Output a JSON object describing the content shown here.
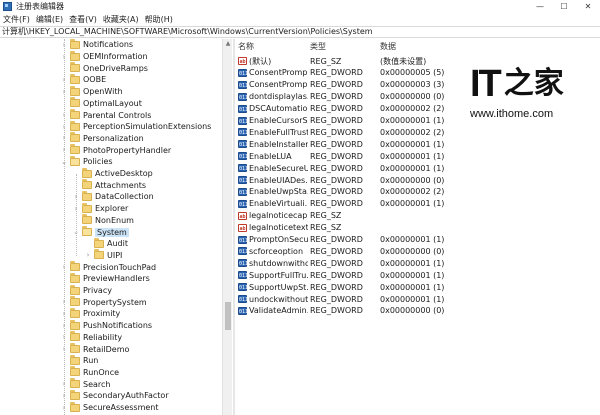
{
  "window": {
    "title": "注册表编辑器",
    "controls": {
      "minimize": "—",
      "maximize": "☐",
      "close": "✕"
    }
  },
  "menu": [
    "文件(F)",
    "编辑(E)",
    "查看(V)",
    "收藏夹(A)",
    "帮助(H)"
  ],
  "address": "计算机\\HKEY_LOCAL_MACHINE\\SOFTWARE\\Microsoft\\Windows\\CurrentVersion\\Policies\\System",
  "tree": [
    {
      "label": "Notifications",
      "depth": 0,
      "expander": "collapsed",
      "selected": false
    },
    {
      "label": "OEMInformation",
      "depth": 0,
      "expander": "collapsed",
      "selected": false
    },
    {
      "label": "OneDriveRamps",
      "depth": 0,
      "expander": "none",
      "selected": false
    },
    {
      "label": "OOBE",
      "depth": 0,
      "expander": "collapsed",
      "selected": false
    },
    {
      "label": "OpenWith",
      "depth": 0,
      "expander": "collapsed",
      "selected": false
    },
    {
      "label": "OptimalLayout",
      "depth": 0,
      "expander": "none",
      "selected": false
    },
    {
      "label": "Parental Controls",
      "depth": 0,
      "expander": "collapsed",
      "selected": false
    },
    {
      "label": "PerceptionSimulationExtensions",
      "depth": 0,
      "expander": "collapsed",
      "selected": false
    },
    {
      "label": "Personalization",
      "depth": 0,
      "expander": "collapsed",
      "selected": false
    },
    {
      "label": "PhotoPropertyHandler",
      "depth": 0,
      "expander": "collapsed",
      "selected": false
    },
    {
      "label": "Policies",
      "depth": 0,
      "expander": "expanded",
      "selected": false
    },
    {
      "label": "ActiveDesktop",
      "depth": 1,
      "expander": "none",
      "selected": false
    },
    {
      "label": "Attachments",
      "depth": 1,
      "expander": "none",
      "selected": false
    },
    {
      "label": "DataCollection",
      "depth": 1,
      "expander": "collapsed",
      "selected": false
    },
    {
      "label": "Explorer",
      "depth": 1,
      "expander": "collapsed",
      "selected": false
    },
    {
      "label": "NonEnum",
      "depth": 1,
      "expander": "none",
      "selected": false
    },
    {
      "label": "System",
      "depth": 1,
      "expander": "expanded",
      "selected": true
    },
    {
      "label": "Audit",
      "depth": 2,
      "expander": "none",
      "selected": false
    },
    {
      "label": "UIPI",
      "depth": 2,
      "expander": "collapsed",
      "selected": false
    },
    {
      "label": "PrecisionTouchPad",
      "depth": 0,
      "expander": "collapsed",
      "selected": false
    },
    {
      "label": "PreviewHandlers",
      "depth": 0,
      "expander": "none",
      "selected": false
    },
    {
      "label": "Privacy",
      "depth": 0,
      "expander": "none",
      "selected": false
    },
    {
      "label": "PropertySystem",
      "depth": 0,
      "expander": "collapsed",
      "selected": false
    },
    {
      "label": "Proximity",
      "depth": 0,
      "expander": "collapsed",
      "selected": false
    },
    {
      "label": "PushNotifications",
      "depth": 0,
      "expander": "collapsed",
      "selected": false
    },
    {
      "label": "Reliability",
      "depth": 0,
      "expander": "collapsed",
      "selected": false
    },
    {
      "label": "RetailDemo",
      "depth": 0,
      "expander": "collapsed",
      "selected": false
    },
    {
      "label": "Run",
      "depth": 0,
      "expander": "none",
      "selected": false
    },
    {
      "label": "RunOnce",
      "depth": 0,
      "expander": "none",
      "selected": false
    },
    {
      "label": "Search",
      "depth": 0,
      "expander": "collapsed",
      "selected": false
    },
    {
      "label": "SecondaryAuthFactor",
      "depth": 0,
      "expander": "collapsed",
      "selected": false
    },
    {
      "label": "SecureAssessment",
      "depth": 0,
      "expander": "collapsed",
      "selected": false
    }
  ],
  "columns": {
    "name": "名称",
    "type": "类型",
    "data": "数据"
  },
  "values": [
    {
      "kind": "sz",
      "name": "(默认)",
      "type": "REG_SZ",
      "data": "(数值未设置)"
    },
    {
      "kind": "dw",
      "name": "ConsentPromp...",
      "type": "REG_DWORD",
      "data": "0x00000005 (5)"
    },
    {
      "kind": "dw",
      "name": "ConsentPromp...",
      "type": "REG_DWORD",
      "data": "0x00000003 (3)"
    },
    {
      "kind": "dw",
      "name": "dontdisplaylas...",
      "type": "REG_DWORD",
      "data": "0x00000000 (0)"
    },
    {
      "kind": "dw",
      "name": "DSCAutomatio...",
      "type": "REG_DWORD",
      "data": "0x00000002 (2)"
    },
    {
      "kind": "dw",
      "name": "EnableCursorS...",
      "type": "REG_DWORD",
      "data": "0x00000001 (1)"
    },
    {
      "kind": "dw",
      "name": "EnableFullTrust...",
      "type": "REG_DWORD",
      "data": "0x00000002 (2)"
    },
    {
      "kind": "dw",
      "name": "EnableInstaller...",
      "type": "REG_DWORD",
      "data": "0x00000001 (1)"
    },
    {
      "kind": "dw",
      "name": "EnableLUA",
      "type": "REG_DWORD",
      "data": "0x00000001 (1)"
    },
    {
      "kind": "dw",
      "name": "EnableSecureU...",
      "type": "REG_DWORD",
      "data": "0x00000001 (1)"
    },
    {
      "kind": "dw",
      "name": "EnableUIADes...",
      "type": "REG_DWORD",
      "data": "0x00000000 (0)"
    },
    {
      "kind": "dw",
      "name": "EnableUwpSta...",
      "type": "REG_DWORD",
      "data": "0x00000002 (2)"
    },
    {
      "kind": "dw",
      "name": "EnableVirtuali...",
      "type": "REG_DWORD",
      "data": "0x00000001 (1)"
    },
    {
      "kind": "sz",
      "name": "legalnoticecap...",
      "type": "REG_SZ",
      "data": ""
    },
    {
      "kind": "sz",
      "name": "legalnoticetext",
      "type": "REG_SZ",
      "data": ""
    },
    {
      "kind": "dw",
      "name": "PromptOnSecu...",
      "type": "REG_DWORD",
      "data": "0x00000001 (1)"
    },
    {
      "kind": "dw",
      "name": "scforceoption",
      "type": "REG_DWORD",
      "data": "0x00000000 (0)"
    },
    {
      "kind": "dw",
      "name": "shutdownwitho...",
      "type": "REG_DWORD",
      "data": "0x00000001 (1)"
    },
    {
      "kind": "dw",
      "name": "SupportFullTru...",
      "type": "REG_DWORD",
      "data": "0x00000001 (1)"
    },
    {
      "kind": "dw",
      "name": "SupportUwpSt...",
      "type": "REG_DWORD",
      "data": "0x00000001 (1)"
    },
    {
      "kind": "dw",
      "name": "undockwithout...",
      "type": "REG_DWORD",
      "data": "0x00000001 (1)"
    },
    {
      "kind": "dw",
      "name": "ValidateAdmin...",
      "type": "REG_DWORD",
      "data": "0x00000000 (0)"
    }
  ],
  "icons": {
    "sz": "ab",
    "dw": "011"
  },
  "watermark": {
    "logo_it": "IT",
    "logo_char": "之家",
    "url": "www.ithome.com"
  }
}
